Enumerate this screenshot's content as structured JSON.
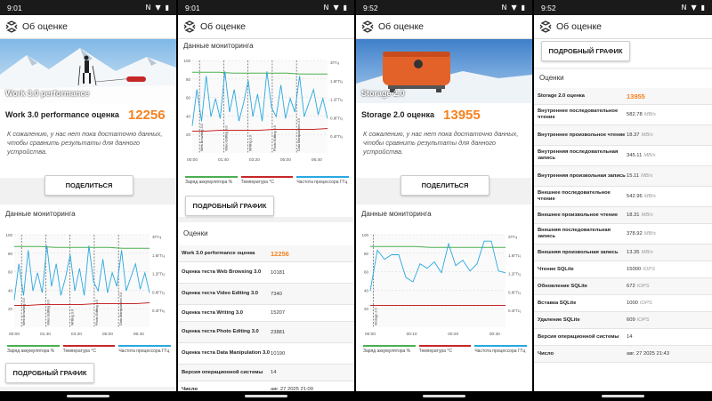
{
  "status": {
    "time_1": "9:01",
    "time_2": "9:01",
    "time_3": "9:52",
    "time_4": "9:52"
  },
  "app": {
    "title": "Об оценке"
  },
  "pane1": {
    "hero_label": "Work 3.0 performance",
    "score_name": "Work 3.0 performance оценка",
    "score_value": "12256",
    "message": "К сожалению, у нас нет пока достаточно данных, чтобы сравнить результаты для данного устройства.",
    "share_button": "ПОДЕЛИТЬСЯ",
    "monitoring_title": "Данные мониторинга",
    "detail_button": "ПОДРОБНЫЙ ГРАФИК"
  },
  "pane2": {
    "monitoring_title": "Данные мониторинга",
    "detail_button": "ПОДРОБНЫЙ ГРАФИК",
    "scores_title": "Оценки",
    "rows": [
      {
        "label": "Work 3.0 performance оценка",
        "value": "12256",
        "highlight": true
      },
      {
        "label": "Оценка теста Web Browsing 3.0",
        "value": "10181"
      },
      {
        "label": "Оценка теста Video Editing 3.0",
        "value": "7340"
      },
      {
        "label": "Оценка теста Writing 3.0",
        "value": "15207"
      },
      {
        "label": "Оценка теста Photo Editing 3.0",
        "value": "23881"
      },
      {
        "label": "Оценка теста Data Manipulation 3.0",
        "value": "10190"
      },
      {
        "label": "Версия операционной системы",
        "value": "14"
      },
      {
        "label": "Число",
        "value": "авг. 27 2025 21:00"
      }
    ]
  },
  "pane3": {
    "hero_label": "Storage 2.0",
    "hero_sub": "2.0",
    "score_name": "Storage 2.0 оценка",
    "score_value": "13955",
    "message": "К сожалению, у нас нет пока достаточно данных, чтобы сравнить результаты для данного устройства.",
    "share_button": "ПОДЕЛИТЬСЯ",
    "monitoring_title": "Данные мониторинга"
  },
  "pane4": {
    "detail_button": "ПОДРОБНЫЙ ГРАФИК",
    "scores_title": "Оценки",
    "rows": [
      {
        "label": "Storage 2.0 оценка",
        "value": "13955",
        "unit": "",
        "highlight": true
      },
      {
        "label": "Внутреннее последовательное чтение",
        "value": "582.78",
        "unit": "MB/s"
      },
      {
        "label": "Внутреннее произвольное чтение",
        "value": "18.37",
        "unit": "MB/s"
      },
      {
        "label": "Внутренняя последовательная запись",
        "value": "345.11",
        "unit": "MB/s"
      },
      {
        "label": "Внутренняя произвольная запись",
        "value": "15.11",
        "unit": "MB/s"
      },
      {
        "label": "Внешнее последовательное чтение",
        "value": "542.96",
        "unit": "MB/s"
      },
      {
        "label": "Внешнее произвольное чтение",
        "value": "18.31",
        "unit": "MB/s"
      },
      {
        "label": "Внешняя последовательная запись",
        "value": "378.92",
        "unit": "MB/s"
      },
      {
        "label": "Внешняя произвольная запись",
        "value": "13.35",
        "unit": "MB/s"
      },
      {
        "label": "Чтение SQLite",
        "value": "15000",
        "unit": "IOPS"
      },
      {
        "label": "Обновление SQLite",
        "value": "672",
        "unit": "IOPS"
      },
      {
        "label": "Вставка SQLite",
        "value": "1000",
        "unit": "IOPS"
      },
      {
        "label": "Удаление SQLite",
        "value": "609",
        "unit": "IOPS"
      },
      {
        "label": "Версия операционной системы",
        "value": "14",
        "unit": ""
      },
      {
        "label": "Число",
        "value": "авг. 27 2025 21:43",
        "unit": ""
      }
    ]
  },
  "legend": {
    "battery": "Заряд аккумулятора %",
    "temp": "Температура °С",
    "cpu": "Частота процессора ГГц"
  },
  "colors": {
    "accent": "#f58220",
    "battery": "#4caf50",
    "temp": "#c62828",
    "cpu": "#29a8e0"
  },
  "chart_data": [
    {
      "type": "line",
      "x_ticks": [
        "00:00",
        "01:40",
        "03:20",
        "05:00",
        "06:40"
      ],
      "y_ticks_left": [
        "100",
        "80",
        "60",
        "40",
        "20"
      ],
      "y_ticks_right": [
        "3ГГц",
        "1.6ГГц",
        "1.2ГГц",
        "0.8ГГц",
        "0.4ГГц"
      ],
      "markers": [
        "Web Browsing 3.0",
        "Video Editing 3.0",
        "Writing 3.0",
        "Photo Editing 3.0",
        "Data Manipulation 3.0"
      ],
      "series": [
        {
          "name": "Заряд аккумулятора %",
          "values": [
            89,
            89,
            89,
            88,
            88,
            88,
            88,
            88,
            87,
            87,
            87
          ]
        },
        {
          "name": "Температура °С",
          "values": [
            24,
            24,
            25,
            25,
            25,
            25,
            26,
            26,
            26,
            26,
            27
          ]
        },
        {
          "name": "Частота процессора ГГц",
          "values": [
            30,
            70,
            35,
            85,
            40,
            60,
            38,
            90,
            45,
            70,
            35,
            55,
            80,
            40,
            65,
            35,
            90,
            50,
            40,
            75,
            38,
            60,
            45,
            85,
            40,
            55,
            70,
            42,
            60,
            38
          ]
        }
      ]
    },
    {
      "type": "line",
      "x_ticks": [
        "00:00",
        "00:10",
        "00:20",
        "00:30"
      ],
      "y_ticks_left": [
        "100",
        "80",
        "60",
        "40",
        "20"
      ],
      "y_ticks_right": [
        "2ГГц",
        "1.6ГГц",
        "1.2ГГц",
        "0.8ГГц",
        "0.4ГГц"
      ],
      "markers": [
        "Storage 2.0"
      ],
      "series": [
        {
          "name": "Заряд аккумулятора %",
          "values": [
            89,
            89,
            89,
            89,
            88,
            88,
            88,
            88,
            88,
            88
          ]
        },
        {
          "name": "Температура °С",
          "values": [
            24,
            24,
            24,
            24,
            24,
            24,
            24,
            24,
            24,
            24
          ]
        },
        {
          "name": "Частота процессора ГГц",
          "values": [
            40,
            85,
            75,
            80,
            80,
            55,
            50,
            70,
            65,
            72,
            60,
            92,
            68,
            74,
            62,
            70,
            95,
            95,
            62,
            60
          ]
        }
      ]
    }
  ]
}
